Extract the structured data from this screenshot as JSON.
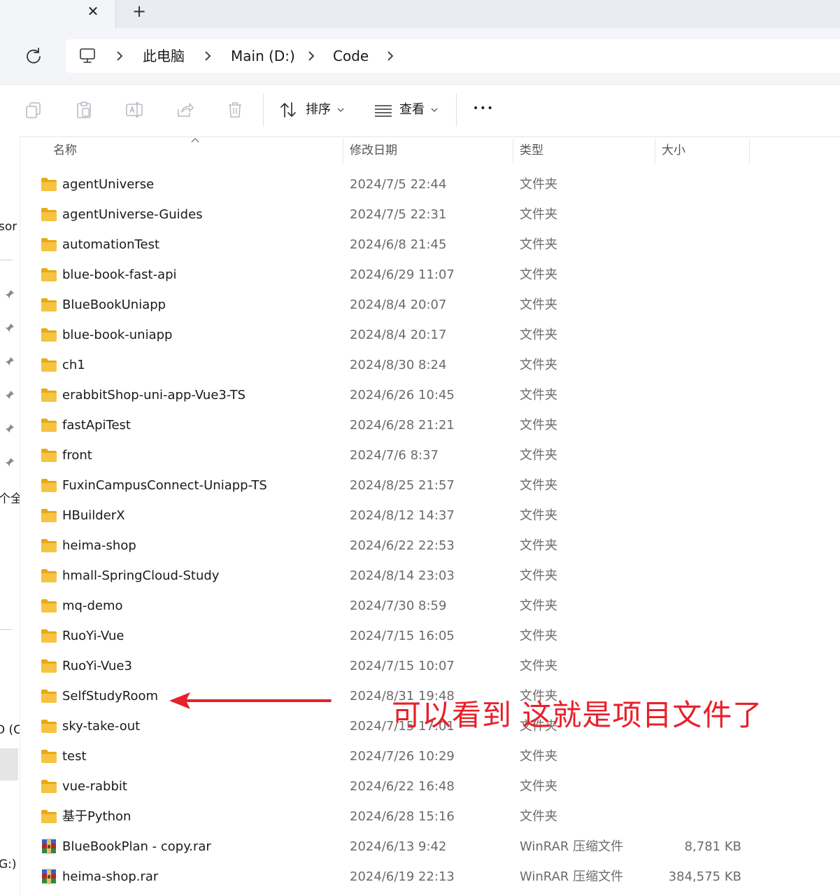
{
  "tabs": {
    "close_glyph": "✕",
    "new_glyph": "+"
  },
  "breadcrumb": {
    "items": [
      "此电脑",
      "Main (D:)",
      "Code"
    ]
  },
  "toolbar": {
    "sort_label": "排序",
    "view_label": "查看",
    "more_glyph": "•••"
  },
  "nav": {
    "fragments": [
      "sor",
      "个全",
      "D (C",
      "G:)"
    ]
  },
  "columns": {
    "name": "名称",
    "date": "修改日期",
    "type": "类型",
    "size": "大小"
  },
  "files": [
    {
      "name": "agentUniverse",
      "date": "2024/7/5 22:44",
      "type": "文件夹",
      "size": "",
      "icon": "folder-icon"
    },
    {
      "name": "agentUniverse-Guides",
      "date": "2024/7/5 22:31",
      "type": "文件夹",
      "size": "",
      "icon": "folder-icon"
    },
    {
      "name": "automationTest",
      "date": "2024/6/8 21:45",
      "type": "文件夹",
      "size": "",
      "icon": "folder-icon"
    },
    {
      "name": "blue-book-fast-api",
      "date": "2024/6/29 11:07",
      "type": "文件夹",
      "size": "",
      "icon": "folder-icon"
    },
    {
      "name": "BlueBookUniapp",
      "date": "2024/8/4 20:07",
      "type": "文件夹",
      "size": "",
      "icon": "folder-icon"
    },
    {
      "name": "blue-book-uniapp",
      "date": "2024/8/4 20:17",
      "type": "文件夹",
      "size": "",
      "icon": "folder-icon"
    },
    {
      "name": "ch1",
      "date": "2024/8/30 8:24",
      "type": "文件夹",
      "size": "",
      "icon": "folder-icon"
    },
    {
      "name": "erabbitShop-uni-app-Vue3-TS",
      "date": "2024/6/26 10:45",
      "type": "文件夹",
      "size": "",
      "icon": "folder-icon"
    },
    {
      "name": "fastApiTest",
      "date": "2024/6/28 21:21",
      "type": "文件夹",
      "size": "",
      "icon": "folder-icon"
    },
    {
      "name": "front",
      "date": "2024/7/6 8:37",
      "type": "文件夹",
      "size": "",
      "icon": "folder-icon"
    },
    {
      "name": "FuxinCampusConnect-Uniapp-TS",
      "date": "2024/8/25 21:57",
      "type": "文件夹",
      "size": "",
      "icon": "folder-icon"
    },
    {
      "name": "HBuilderX",
      "date": "2024/8/12 14:37",
      "type": "文件夹",
      "size": "",
      "icon": "folder-icon"
    },
    {
      "name": "heima-shop",
      "date": "2024/6/22 22:53",
      "type": "文件夹",
      "size": "",
      "icon": "folder-icon"
    },
    {
      "name": "hmall-SpringCloud-Study",
      "date": "2024/8/14 23:03",
      "type": "文件夹",
      "size": "",
      "icon": "folder-icon"
    },
    {
      "name": "mq-demo",
      "date": "2024/7/30 8:59",
      "type": "文件夹",
      "size": "",
      "icon": "folder-icon"
    },
    {
      "name": "RuoYi-Vue",
      "date": "2024/7/15 16:05",
      "type": "文件夹",
      "size": "",
      "icon": "folder-icon"
    },
    {
      "name": "RuoYi-Vue3",
      "date": "2024/7/15 10:07",
      "type": "文件夹",
      "size": "",
      "icon": "folder-icon"
    },
    {
      "name": "SelfStudyRoom",
      "date": "2024/8/31 19:48",
      "type": "文件夹",
      "size": "",
      "icon": "folder-icon"
    },
    {
      "name": "sky-take-out",
      "date": "2024/7/15 17:01",
      "type": "文件夹",
      "size": "",
      "icon": "folder-icon"
    },
    {
      "name": "test",
      "date": "2024/7/26 10:29",
      "type": "文件夹",
      "size": "",
      "icon": "folder-icon"
    },
    {
      "name": "vue-rabbit",
      "date": "2024/6/22 16:48",
      "type": "文件夹",
      "size": "",
      "icon": "folder-icon"
    },
    {
      "name": "基于Python",
      "date": "2024/6/28 15:16",
      "type": "文件夹",
      "size": "",
      "icon": "folder-icon"
    },
    {
      "name": "BlueBookPlan - copy.rar",
      "date": "2024/6/13 9:42",
      "type": "WinRAR 压缩文件",
      "size": "8,781 KB",
      "icon": "winrar-archive-icon"
    },
    {
      "name": "heima-shop.rar",
      "date": "2024/6/19 22:13",
      "type": "WinRAR 压缩文件",
      "size": "384,575 KB",
      "icon": "winrar-archive-icon"
    }
  ],
  "annotation": {
    "text": "可以看到 这就是项目文件了",
    "color": "#e8202a"
  },
  "colors": {
    "folder": "#f6c342",
    "folder_dark": "#e8a917",
    "accent_red": "#e8202a"
  }
}
